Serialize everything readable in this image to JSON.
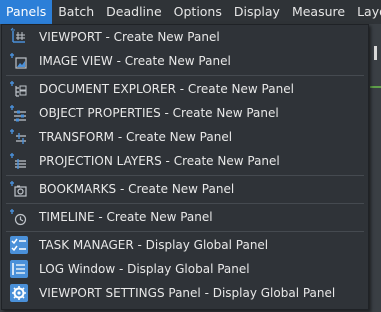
{
  "menubar": {
    "items": [
      {
        "label": "Panels",
        "active": true
      },
      {
        "label": "Batch"
      },
      {
        "label": "Deadline"
      },
      {
        "label": "Options"
      },
      {
        "label": "Display"
      },
      {
        "label": "Measure"
      },
      {
        "label": "Layout"
      }
    ]
  },
  "dropdown": {
    "items": [
      {
        "label": "VIEWPORT - Create New Panel",
        "icon": "viewport-icon"
      },
      {
        "label": "IMAGE VIEW - Create New Panel",
        "icon": "image-view-icon"
      },
      {
        "label": "DOCUMENT EXPLORER - Create New Panel",
        "icon": "document-explorer-icon"
      },
      {
        "label": "OBJECT PROPERTIES - Create New Panel",
        "icon": "object-properties-icon"
      },
      {
        "label": "TRANSFORM - Create New Panel",
        "icon": "transform-icon"
      },
      {
        "label": "PROJECTION LAYERS - Create New Panel",
        "icon": "projection-layers-icon"
      },
      {
        "label": "BOOKMARKS - Create New Panel",
        "icon": "bookmarks-icon"
      },
      {
        "label": "TIMELINE - Create New Panel",
        "icon": "timeline-icon"
      },
      {
        "label": "TASK MANAGER - Display Global Panel",
        "icon": "task-manager-icon"
      },
      {
        "label": "LOG Window - Display Global Panel",
        "icon": "log-window-icon"
      },
      {
        "label": "VIEWPORT SETTINGS Panel - Display Global Panel",
        "icon": "viewport-settings-icon"
      }
    ]
  },
  "colors": {
    "accent": "#2c7fd8",
    "menu_bg": "#2f3338",
    "icon_blue": "#4a90d9"
  }
}
